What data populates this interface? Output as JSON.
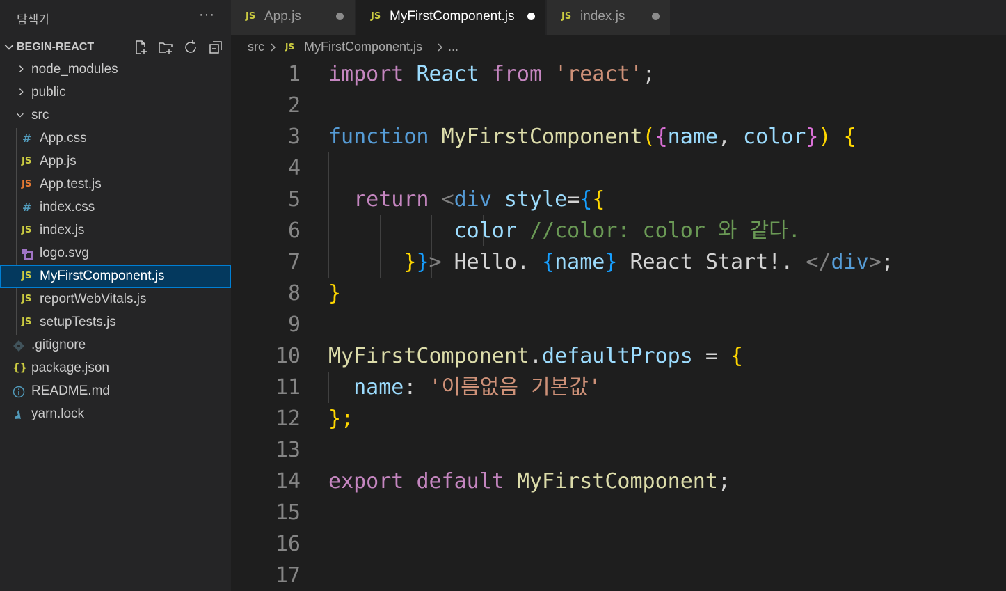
{
  "explorer": {
    "title": "탐색기",
    "more": "···",
    "project": "BEGIN-REACT",
    "items": [
      {
        "label": "node_modules",
        "icon": "chevron-right-icon"
      },
      {
        "label": "public",
        "icon": "chevron-right-icon"
      },
      {
        "label": "src",
        "icon": "chevron-down-icon"
      },
      {
        "label": "App.css",
        "badge": "#",
        "color": "#519aba"
      },
      {
        "label": "App.js",
        "badge": "JS",
        "color": "#cbcb41"
      },
      {
        "label": "App.test.js",
        "badge": "JS",
        "color": "#e37933"
      },
      {
        "label": "index.css",
        "badge": "#",
        "color": "#519aba"
      },
      {
        "label": "index.js",
        "badge": "JS",
        "color": "#cbcb41"
      },
      {
        "label": "logo.svg",
        "icon": "svg-file-icon",
        "color": "#a074c4"
      },
      {
        "label": "MyFirstComponent.js",
        "badge": "JS",
        "color": "#cbcb41",
        "selected": true
      },
      {
        "label": "reportWebVitals.js",
        "badge": "JS",
        "color": "#cbcb41"
      },
      {
        "label": "setupTests.js",
        "badge": "JS",
        "color": "#cbcb41"
      },
      {
        "label": ".gitignore",
        "icon": "git-icon",
        "color": "#41535b"
      },
      {
        "label": "package.json",
        "badge": "{}",
        "color": "#cbcb41"
      },
      {
        "label": "README.md",
        "icon": "info-icon",
        "color": "#519aba"
      },
      {
        "label": "yarn.lock",
        "icon": "yarn-icon",
        "color": "#519aba"
      }
    ]
  },
  "tabs": [
    {
      "label": "App.js",
      "badge": "JS",
      "modified": true
    },
    {
      "label": "MyFirstComponent.js",
      "badge": "JS",
      "modified": true,
      "active": true
    },
    {
      "label": "index.js",
      "badge": "JS",
      "modified": true
    }
  ],
  "breadcrumb": {
    "folder": "src",
    "badge": "JS",
    "file": "MyFirstComponent.js",
    "ellipsis": "..."
  },
  "editor": {
    "line_numbers": [
      "1",
      "2",
      "3",
      "4",
      "5",
      "6",
      "7",
      "8",
      "9",
      "10",
      "11",
      "12",
      "13",
      "14",
      "15",
      "16",
      "17"
    ],
    "lines": {
      "l1": {
        "import": "import",
        "react": "React",
        "from": "from",
        "str": "'react'",
        "semi": ";"
      },
      "l3": {
        "function": "function",
        "name": "MyFirstComponent",
        "open": "(",
        "lb": "{",
        "p1": "name",
        "comma": ",",
        "p2": "color",
        "rb": "}",
        "close": ")",
        "brace": "{"
      },
      "l5": {
        "return": "return",
        "lt": "<",
        "tag": "div",
        "attr": "style",
        "eq": "=",
        "b1": "{",
        "b2": "{"
      },
      "l6": {
        "prop": "color",
        "comment": "//color: color 와 같다."
      },
      "l7": {
        "b2": "}",
        "b1": "}",
        "gt": ">",
        "text1": "Hello. ",
        "lb": "{",
        "expr": "name",
        "rb": "}",
        "text2": "React Start!. ",
        "closetag_open": "</",
        "tag": "div",
        "gt2": ">",
        "semi": ";"
      },
      "l8": {
        "brace": "}"
      },
      "l10": {
        "obj": "MyFirstComponent",
        "dot": ".",
        "prop": "defaultProps",
        "eq": " = ",
        "brace": "{"
      },
      "l11": {
        "key": "name",
        "colon": ": ",
        "str": "'이름없음 기본값'"
      },
      "l12": {
        "close": "};"
      },
      "l14": {
        "export": "export",
        "default": "default",
        "name": "MyFirstComponent",
        "semi": ";"
      }
    }
  }
}
